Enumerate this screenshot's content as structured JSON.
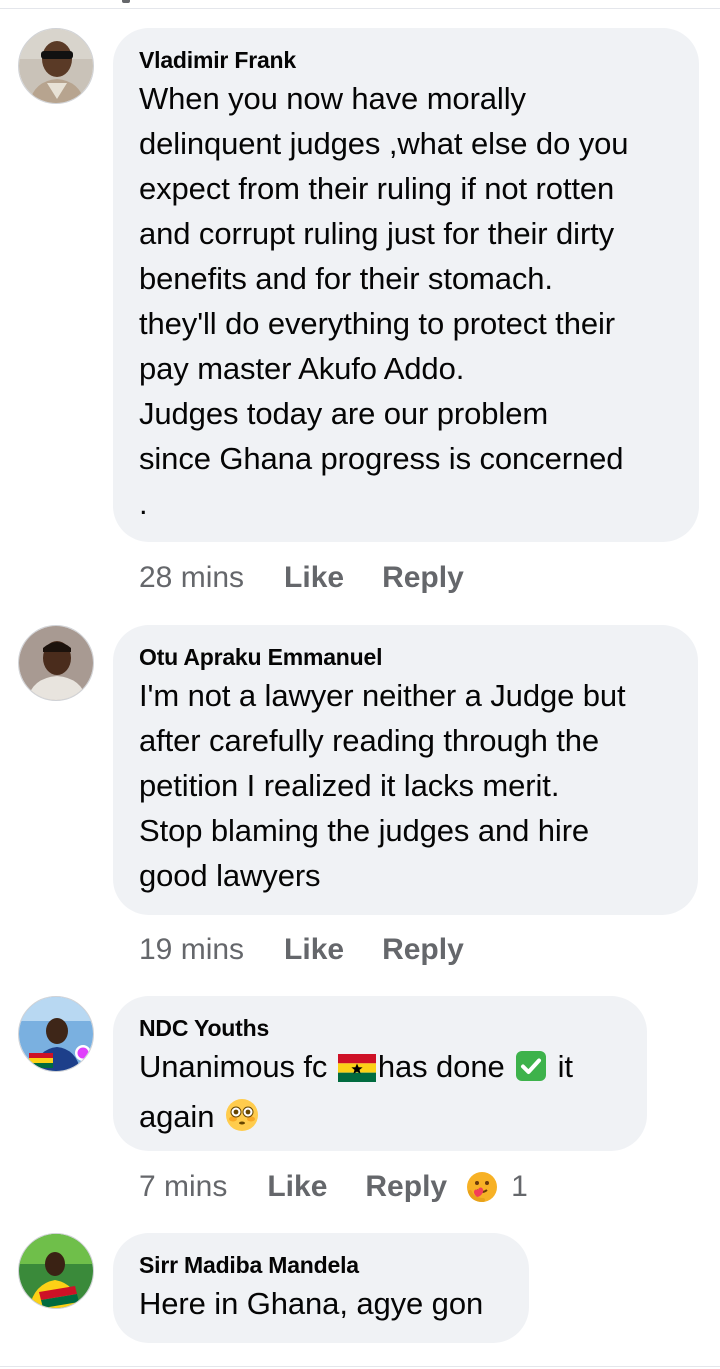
{
  "comments": [
    {
      "author": "Vladimir Frank",
      "text": "When you now have morally\ndelinquent judges ,what else do you\nexpect from their ruling if not rotten\nand corrupt ruling just for their dirty\nbenefits and for their stomach.\nthey'll do everything to protect their\npay master Akufo Addo.\nJudges today are our problem\nsince Ghana progress is concerned\n.",
      "time": "28 mins",
      "like_label": "Like",
      "reply_label": "Reply"
    },
    {
      "author": "Otu Apraku Emmanuel",
      "text": "I'm not a lawyer neither a Judge but\nafter carefully reading through the\npetition I realized it lacks merit.\nStop blaming the judges and hire\ngood lawyers",
      "time": "19 mins",
      "like_label": "Like",
      "reply_label": "Reply"
    },
    {
      "author": "NDC Youths",
      "text_part1": "Unanimous fc ",
      "text_part2": "has done ",
      "text_part3": " it",
      "text_part4": "again ",
      "time": "7 mins",
      "like_label": "Like",
      "reply_label": "Reply",
      "reaction_count": "1",
      "reaction_icon": "care-reaction-icon"
    },
    {
      "author": "Sirr Madiba Mandela",
      "text": "Here in Ghana, agye gon"
    }
  ],
  "colors": {
    "bubble_bg": "#f0f2f5",
    "meta_text": "#65676b",
    "text": "#050505"
  }
}
